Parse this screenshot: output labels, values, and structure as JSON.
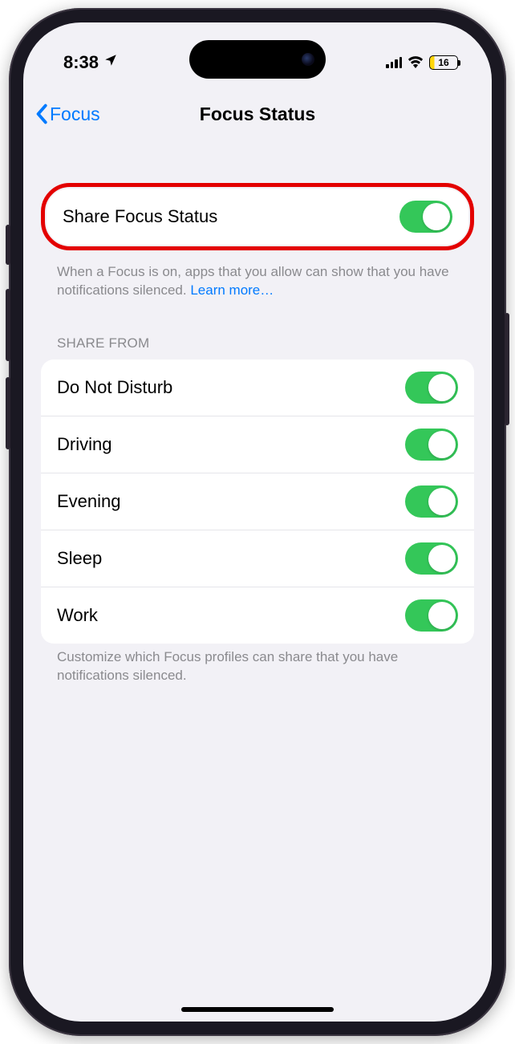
{
  "status": {
    "time": "8:38",
    "battery_pct": "16"
  },
  "nav": {
    "back_label": "Focus",
    "title": "Focus Status"
  },
  "share_status": {
    "label": "Share Focus Status",
    "footer": "When a Focus is on, apps that you allow can show that you have notifications silenced. ",
    "learn_more": "Learn more…"
  },
  "share_from": {
    "header": "Share From",
    "items": [
      {
        "label": "Do Not Disturb"
      },
      {
        "label": "Driving"
      },
      {
        "label": "Evening"
      },
      {
        "label": "Sleep"
      },
      {
        "label": "Work"
      }
    ],
    "footer": "Customize which Focus profiles can share that you have notifications silenced."
  }
}
